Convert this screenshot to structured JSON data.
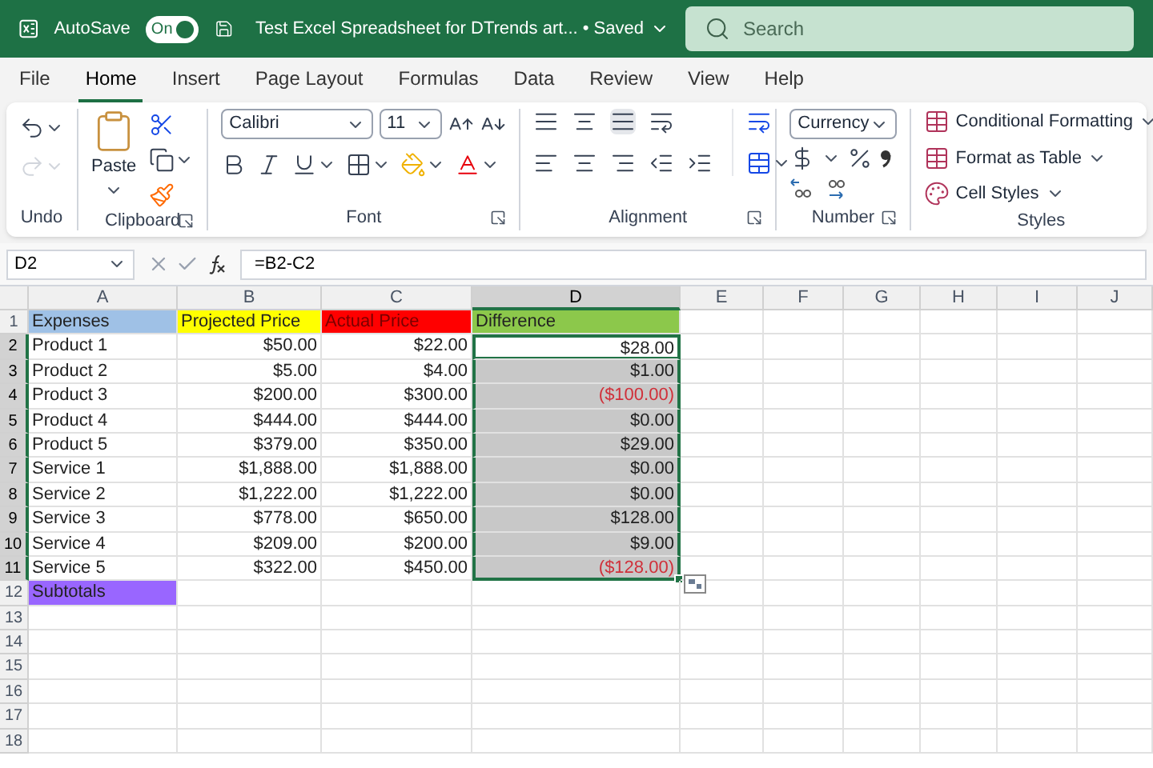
{
  "title_bar": {
    "autosave_label": "AutoSave",
    "autosave": {
      "on": true,
      "label": "On"
    },
    "document_title": "Test Excel Spreadsheet for DTrends art... • Saved",
    "search": {
      "placeholder": "Search"
    }
  },
  "tabs": [
    {
      "label": "File",
      "selected": false
    },
    {
      "label": "Home",
      "selected": true
    },
    {
      "label": "Insert",
      "selected": false
    },
    {
      "label": "Page Layout",
      "selected": false
    },
    {
      "label": "Formulas",
      "selected": false
    },
    {
      "label": "Data",
      "selected": false
    },
    {
      "label": "Review",
      "selected": false
    },
    {
      "label": "View",
      "selected": false
    },
    {
      "label": "Help",
      "selected": false
    }
  ],
  "ribbon": {
    "undo": {
      "label": "Undo"
    },
    "clipboard": {
      "label": "Clipboard",
      "paste": "Paste"
    },
    "font": {
      "label": "Font",
      "font_name": "Calibri",
      "font_size": "11"
    },
    "alignment": {
      "label": "Alignment"
    },
    "number": {
      "label": "Number",
      "format": "Currency"
    },
    "styles": {
      "label": "Styles",
      "items": [
        "Conditional Formatting",
        "Format as Table",
        "Cell Styles"
      ]
    }
  },
  "formula_bar": {
    "name_box": "D2",
    "formula": "=B2-C2"
  },
  "columns": [
    {
      "label": "A",
      "selected": false
    },
    {
      "label": "B",
      "selected": false
    },
    {
      "label": "C",
      "selected": false
    },
    {
      "label": "D",
      "selected": true
    },
    {
      "label": "E",
      "selected": false
    },
    {
      "label": "F",
      "selected": false
    },
    {
      "label": "G",
      "selected": false
    },
    {
      "label": "H",
      "selected": false
    },
    {
      "label": "I",
      "selected": false
    },
    {
      "label": "J",
      "selected": false
    }
  ],
  "rows": [
    {
      "number": "1",
      "selected": false,
      "cells": [
        {
          "text": "Expenses",
          "kind": "text",
          "color": "#9fc1e6",
          "selected": false,
          "active": false
        },
        {
          "text": "Projected Price",
          "kind": "text",
          "color": "#ffff00",
          "selected": false,
          "active": false
        },
        {
          "text": "Actual Price",
          "kind": "hidden",
          "color": "#ff0000",
          "selected": false,
          "active": false
        },
        {
          "text": "Difference",
          "kind": "text",
          "color": "#8cc84b",
          "selected": false,
          "active": false
        }
      ]
    },
    {
      "number": "2",
      "selected": true,
      "cells": [
        {
          "text": "Product 1",
          "kind": "text",
          "selected": false,
          "active": false
        },
        {
          "text": "$50.00",
          "kind": "number",
          "selected": false,
          "active": false
        },
        {
          "text": "$22.00",
          "kind": "number",
          "selected": false,
          "active": false
        },
        {
          "text": "$28.00",
          "kind": "number",
          "selected": true,
          "active": true
        }
      ]
    },
    {
      "number": "3",
      "selected": true,
      "cells": [
        {
          "text": "Product 2",
          "kind": "text",
          "selected": false,
          "active": false
        },
        {
          "text": "$5.00",
          "kind": "number",
          "selected": false,
          "active": false
        },
        {
          "text": "$4.00",
          "kind": "number",
          "selected": false,
          "active": false
        },
        {
          "text": "$1.00",
          "kind": "number",
          "selected": true,
          "active": false
        }
      ]
    },
    {
      "number": "4",
      "selected": true,
      "cells": [
        {
          "text": "Product 3",
          "kind": "text",
          "selected": false,
          "active": false
        },
        {
          "text": "$200.00",
          "kind": "number",
          "selected": false,
          "active": false
        },
        {
          "text": "$300.00",
          "kind": "number",
          "selected": false,
          "active": false
        },
        {
          "text": "($100.00)",
          "kind": "negative",
          "selected": true,
          "active": false
        }
      ]
    },
    {
      "number": "5",
      "selected": true,
      "cells": [
        {
          "text": "Product 4",
          "kind": "text",
          "selected": false,
          "active": false
        },
        {
          "text": "$444.00",
          "kind": "number",
          "selected": false,
          "active": false
        },
        {
          "text": "$444.00",
          "kind": "number",
          "selected": false,
          "active": false
        },
        {
          "text": "$0.00",
          "kind": "number",
          "selected": true,
          "active": false
        }
      ]
    },
    {
      "number": "6",
      "selected": true,
      "cells": [
        {
          "text": "Product 5",
          "kind": "text",
          "selected": false,
          "active": false
        },
        {
          "text": "$379.00",
          "kind": "number",
          "selected": false,
          "active": false
        },
        {
          "text": "$350.00",
          "kind": "number",
          "selected": false,
          "active": false
        },
        {
          "text": "$29.00",
          "kind": "number",
          "selected": true,
          "active": false
        }
      ]
    },
    {
      "number": "7",
      "selected": true,
      "cells": [
        {
          "text": "Service 1",
          "kind": "text",
          "selected": false,
          "active": false
        },
        {
          "text": "$1,888.00",
          "kind": "number",
          "selected": false,
          "active": false
        },
        {
          "text": "$1,888.00",
          "kind": "number",
          "selected": false,
          "active": false
        },
        {
          "text": "$0.00",
          "kind": "number",
          "selected": true,
          "active": false
        }
      ]
    },
    {
      "number": "8",
      "selected": true,
      "cells": [
        {
          "text": "Service 2",
          "kind": "text",
          "selected": false,
          "active": false
        },
        {
          "text": "$1,222.00",
          "kind": "number",
          "selected": false,
          "active": false
        },
        {
          "text": "$1,222.00",
          "kind": "number",
          "selected": false,
          "active": false
        },
        {
          "text": "$0.00",
          "kind": "number",
          "selected": true,
          "active": false
        }
      ]
    },
    {
      "number": "9",
      "selected": true,
      "cells": [
        {
          "text": "Service 3",
          "kind": "text",
          "selected": false,
          "active": false
        },
        {
          "text": "$778.00",
          "kind": "number",
          "selected": false,
          "active": false
        },
        {
          "text": "$650.00",
          "kind": "number",
          "selected": false,
          "active": false
        },
        {
          "text": "$128.00",
          "kind": "number",
          "selected": true,
          "active": false
        }
      ]
    },
    {
      "number": "10",
      "selected": true,
      "cells": [
        {
          "text": "Service 4",
          "kind": "text",
          "selected": false,
          "active": false
        },
        {
          "text": "$209.00",
          "kind": "number",
          "selected": false,
          "active": false
        },
        {
          "text": "$200.00",
          "kind": "number",
          "selected": false,
          "active": false
        },
        {
          "text": "$9.00",
          "kind": "number",
          "selected": true,
          "active": false
        }
      ]
    },
    {
      "number": "11",
      "selected": true,
      "cells": [
        {
          "text": "Service 5",
          "kind": "text",
          "selected": false,
          "active": false
        },
        {
          "text": "$322.00",
          "kind": "number",
          "selected": false,
          "active": false
        },
        {
          "text": "$450.00",
          "kind": "number",
          "selected": false,
          "active": false
        },
        {
          "text": "($128.00)",
          "kind": "negative",
          "selected": true,
          "active": false
        }
      ]
    },
    {
      "number": "12",
      "selected": false,
      "cells": [
        {
          "text": "Subtotals",
          "kind": "text",
          "color": "#9966ff",
          "selected": false,
          "active": false
        }
      ]
    },
    {
      "number": "13",
      "selected": false,
      "cells": []
    },
    {
      "number": "14",
      "selected": false,
      "cells": []
    },
    {
      "number": "15",
      "selected": false,
      "cells": []
    },
    {
      "number": "16",
      "selected": false,
      "cells": []
    },
    {
      "number": "17",
      "selected": false,
      "cells": []
    },
    {
      "number": "18",
      "selected": false,
      "cells": []
    }
  ]
}
